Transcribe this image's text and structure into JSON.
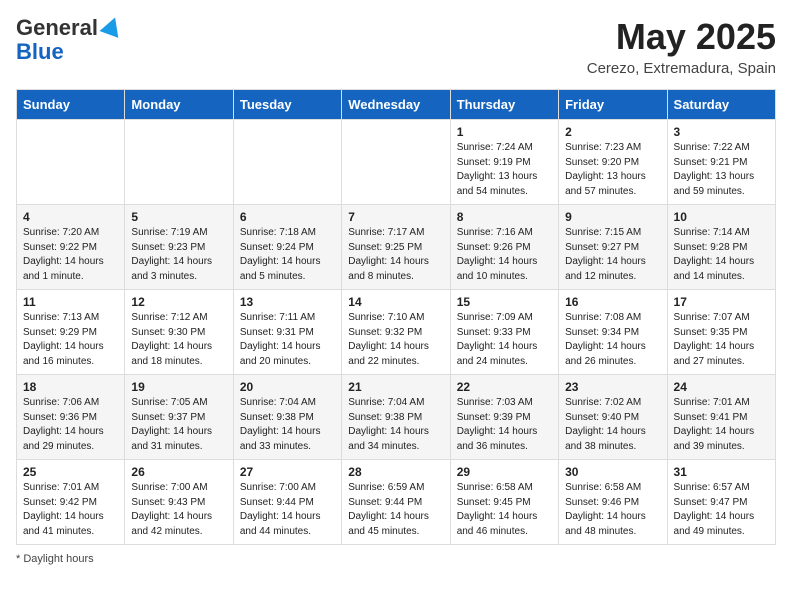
{
  "logo": {
    "general": "General",
    "blue": "Blue"
  },
  "title": "May 2025",
  "subtitle": "Cerezo, Extremadura, Spain",
  "days_of_week": [
    "Sunday",
    "Monday",
    "Tuesday",
    "Wednesday",
    "Thursday",
    "Friday",
    "Saturday"
  ],
  "weeks": [
    [
      {
        "day": "",
        "sunrise": "",
        "sunset": "",
        "daylight": ""
      },
      {
        "day": "",
        "sunrise": "",
        "sunset": "",
        "daylight": ""
      },
      {
        "day": "",
        "sunrise": "",
        "sunset": "",
        "daylight": ""
      },
      {
        "day": "",
        "sunrise": "",
        "sunset": "",
        "daylight": ""
      },
      {
        "day": "1",
        "sunrise": "Sunrise: 7:24 AM",
        "sunset": "Sunset: 9:19 PM",
        "daylight": "Daylight: 13 hours and 54 minutes."
      },
      {
        "day": "2",
        "sunrise": "Sunrise: 7:23 AM",
        "sunset": "Sunset: 9:20 PM",
        "daylight": "Daylight: 13 hours and 57 minutes."
      },
      {
        "day": "3",
        "sunrise": "Sunrise: 7:22 AM",
        "sunset": "Sunset: 9:21 PM",
        "daylight": "Daylight: 13 hours and 59 minutes."
      }
    ],
    [
      {
        "day": "4",
        "sunrise": "Sunrise: 7:20 AM",
        "sunset": "Sunset: 9:22 PM",
        "daylight": "Daylight: 14 hours and 1 minute."
      },
      {
        "day": "5",
        "sunrise": "Sunrise: 7:19 AM",
        "sunset": "Sunset: 9:23 PM",
        "daylight": "Daylight: 14 hours and 3 minutes."
      },
      {
        "day": "6",
        "sunrise": "Sunrise: 7:18 AM",
        "sunset": "Sunset: 9:24 PM",
        "daylight": "Daylight: 14 hours and 5 minutes."
      },
      {
        "day": "7",
        "sunrise": "Sunrise: 7:17 AM",
        "sunset": "Sunset: 9:25 PM",
        "daylight": "Daylight: 14 hours and 8 minutes."
      },
      {
        "day": "8",
        "sunrise": "Sunrise: 7:16 AM",
        "sunset": "Sunset: 9:26 PM",
        "daylight": "Daylight: 14 hours and 10 minutes."
      },
      {
        "day": "9",
        "sunrise": "Sunrise: 7:15 AM",
        "sunset": "Sunset: 9:27 PM",
        "daylight": "Daylight: 14 hours and 12 minutes."
      },
      {
        "day": "10",
        "sunrise": "Sunrise: 7:14 AM",
        "sunset": "Sunset: 9:28 PM",
        "daylight": "Daylight: 14 hours and 14 minutes."
      }
    ],
    [
      {
        "day": "11",
        "sunrise": "Sunrise: 7:13 AM",
        "sunset": "Sunset: 9:29 PM",
        "daylight": "Daylight: 14 hours and 16 minutes."
      },
      {
        "day": "12",
        "sunrise": "Sunrise: 7:12 AM",
        "sunset": "Sunset: 9:30 PM",
        "daylight": "Daylight: 14 hours and 18 minutes."
      },
      {
        "day": "13",
        "sunrise": "Sunrise: 7:11 AM",
        "sunset": "Sunset: 9:31 PM",
        "daylight": "Daylight: 14 hours and 20 minutes."
      },
      {
        "day": "14",
        "sunrise": "Sunrise: 7:10 AM",
        "sunset": "Sunset: 9:32 PM",
        "daylight": "Daylight: 14 hours and 22 minutes."
      },
      {
        "day": "15",
        "sunrise": "Sunrise: 7:09 AM",
        "sunset": "Sunset: 9:33 PM",
        "daylight": "Daylight: 14 hours and 24 minutes."
      },
      {
        "day": "16",
        "sunrise": "Sunrise: 7:08 AM",
        "sunset": "Sunset: 9:34 PM",
        "daylight": "Daylight: 14 hours and 26 minutes."
      },
      {
        "day": "17",
        "sunrise": "Sunrise: 7:07 AM",
        "sunset": "Sunset: 9:35 PM",
        "daylight": "Daylight: 14 hours and 27 minutes."
      }
    ],
    [
      {
        "day": "18",
        "sunrise": "Sunrise: 7:06 AM",
        "sunset": "Sunset: 9:36 PM",
        "daylight": "Daylight: 14 hours and 29 minutes."
      },
      {
        "day": "19",
        "sunrise": "Sunrise: 7:05 AM",
        "sunset": "Sunset: 9:37 PM",
        "daylight": "Daylight: 14 hours and 31 minutes."
      },
      {
        "day": "20",
        "sunrise": "Sunrise: 7:04 AM",
        "sunset": "Sunset: 9:38 PM",
        "daylight": "Daylight: 14 hours and 33 minutes."
      },
      {
        "day": "21",
        "sunrise": "Sunrise: 7:04 AM",
        "sunset": "Sunset: 9:38 PM",
        "daylight": "Daylight: 14 hours and 34 minutes."
      },
      {
        "day": "22",
        "sunrise": "Sunrise: 7:03 AM",
        "sunset": "Sunset: 9:39 PM",
        "daylight": "Daylight: 14 hours and 36 minutes."
      },
      {
        "day": "23",
        "sunrise": "Sunrise: 7:02 AM",
        "sunset": "Sunset: 9:40 PM",
        "daylight": "Daylight: 14 hours and 38 minutes."
      },
      {
        "day": "24",
        "sunrise": "Sunrise: 7:01 AM",
        "sunset": "Sunset: 9:41 PM",
        "daylight": "Daylight: 14 hours and 39 minutes."
      }
    ],
    [
      {
        "day": "25",
        "sunrise": "Sunrise: 7:01 AM",
        "sunset": "Sunset: 9:42 PM",
        "daylight": "Daylight: 14 hours and 41 minutes."
      },
      {
        "day": "26",
        "sunrise": "Sunrise: 7:00 AM",
        "sunset": "Sunset: 9:43 PM",
        "daylight": "Daylight: 14 hours and 42 minutes."
      },
      {
        "day": "27",
        "sunrise": "Sunrise: 7:00 AM",
        "sunset": "Sunset: 9:44 PM",
        "daylight": "Daylight: 14 hours and 44 minutes."
      },
      {
        "day": "28",
        "sunrise": "Sunrise: 6:59 AM",
        "sunset": "Sunset: 9:44 PM",
        "daylight": "Daylight: 14 hours and 45 minutes."
      },
      {
        "day": "29",
        "sunrise": "Sunrise: 6:58 AM",
        "sunset": "Sunset: 9:45 PM",
        "daylight": "Daylight: 14 hours and 46 minutes."
      },
      {
        "day": "30",
        "sunrise": "Sunrise: 6:58 AM",
        "sunset": "Sunset: 9:46 PM",
        "daylight": "Daylight: 14 hours and 48 minutes."
      },
      {
        "day": "31",
        "sunrise": "Sunrise: 6:57 AM",
        "sunset": "Sunset: 9:47 PM",
        "daylight": "Daylight: 14 hours and 49 minutes."
      }
    ]
  ],
  "footer": "Daylight hours"
}
